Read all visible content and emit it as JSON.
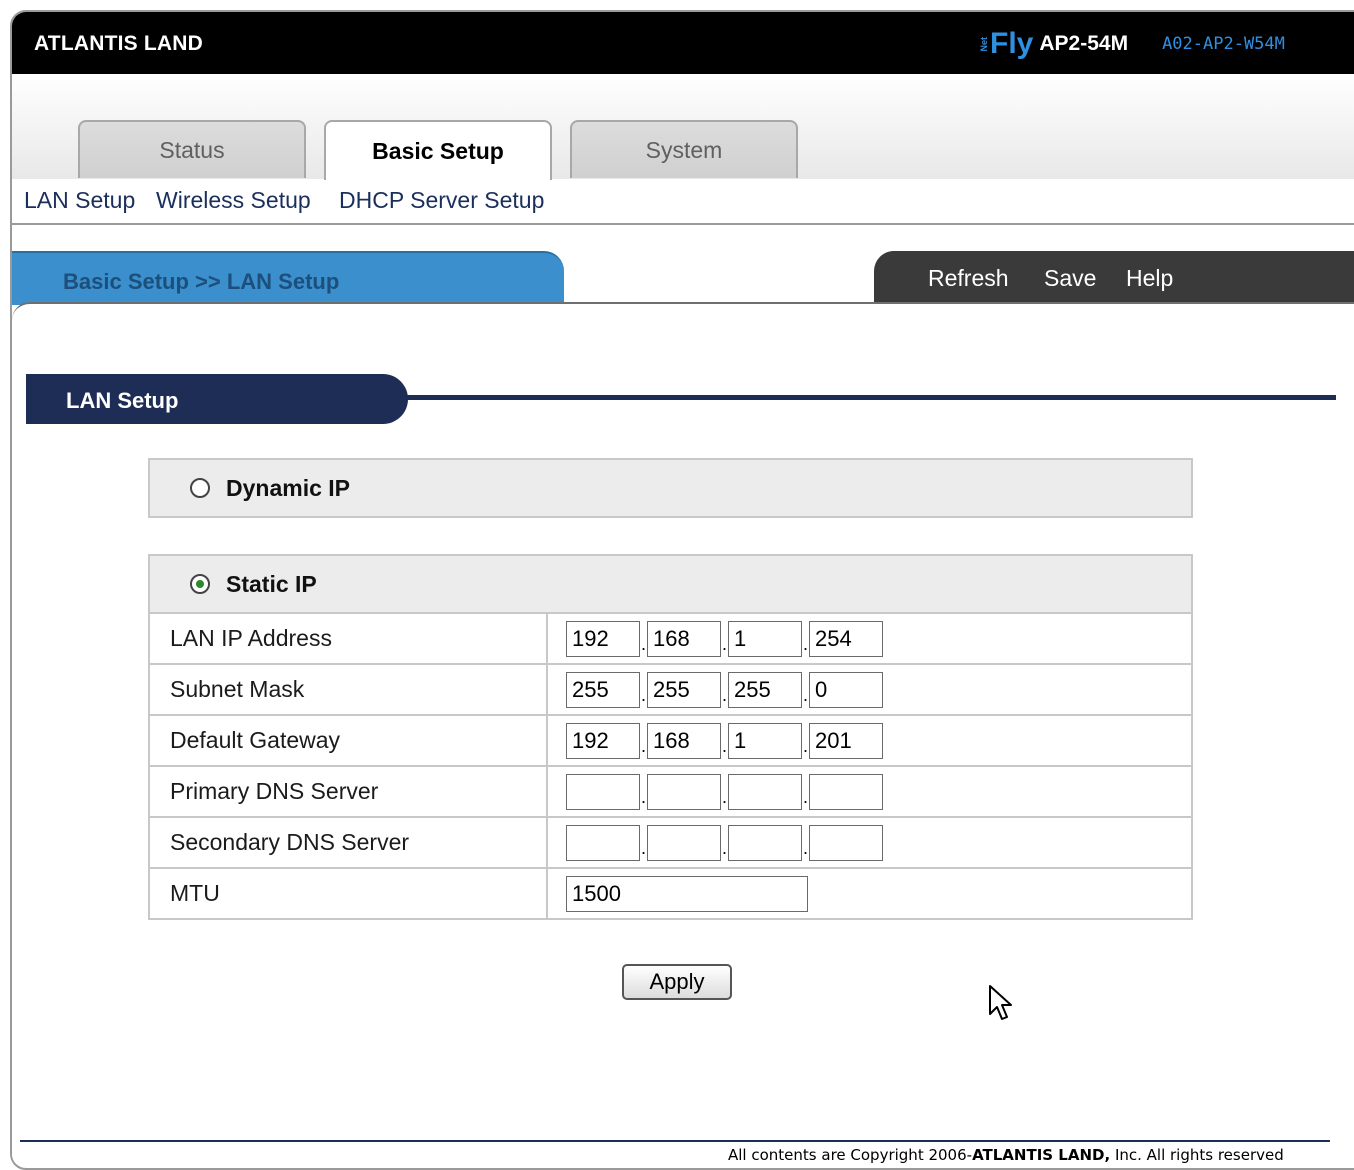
{
  "header": {
    "brand": "ATLANTIS LAND",
    "logo_net": "Net",
    "logo_fly": "Fly",
    "model_name": "AP2-54M",
    "model_code": "A02-AP2-W54M"
  },
  "tabs": [
    {
      "label": "Status",
      "active": false
    },
    {
      "label": "Basic Setup",
      "active": true
    },
    {
      "label": "System",
      "active": false
    }
  ],
  "subnav": [
    "LAN Setup",
    "Wireless Setup",
    "DHCP Server Setup"
  ],
  "breadcrumb": "Basic Setup >> LAN Setup",
  "actions": [
    "Refresh",
    "Save",
    "Help"
  ],
  "panel": {
    "title": "LAN Setup",
    "dynamic_label": "Dynamic IP",
    "static_label": "Static IP",
    "selected_mode": "Static IP",
    "fields": [
      {
        "label": "LAN IP Address",
        "octets": [
          "192",
          "168",
          "1",
          "254"
        ]
      },
      {
        "label": "Subnet Mask",
        "octets": [
          "255",
          "255",
          "255",
          "0"
        ]
      },
      {
        "label": "Default Gateway",
        "octets": [
          "192",
          "168",
          "1",
          "201"
        ]
      },
      {
        "label": "Primary DNS Server",
        "octets": [
          "",
          "",
          "",
          ""
        ]
      },
      {
        "label": "Secondary DNS Server",
        "octets": [
          "",
          "",
          "",
          ""
        ]
      }
    ],
    "mtu_label": "MTU",
    "mtu_value": "1500",
    "apply_label": "Apply"
  },
  "footer": {
    "prefix": "All contents are Copyright  2006-",
    "company": "ATLANTIS LAND,",
    "suffix": " Inc. All rights reserved"
  },
  "colors": {
    "accent_blue": "#3b8fcc",
    "navy": "#1e2d55",
    "logo_blue": "#2f8fe0"
  }
}
